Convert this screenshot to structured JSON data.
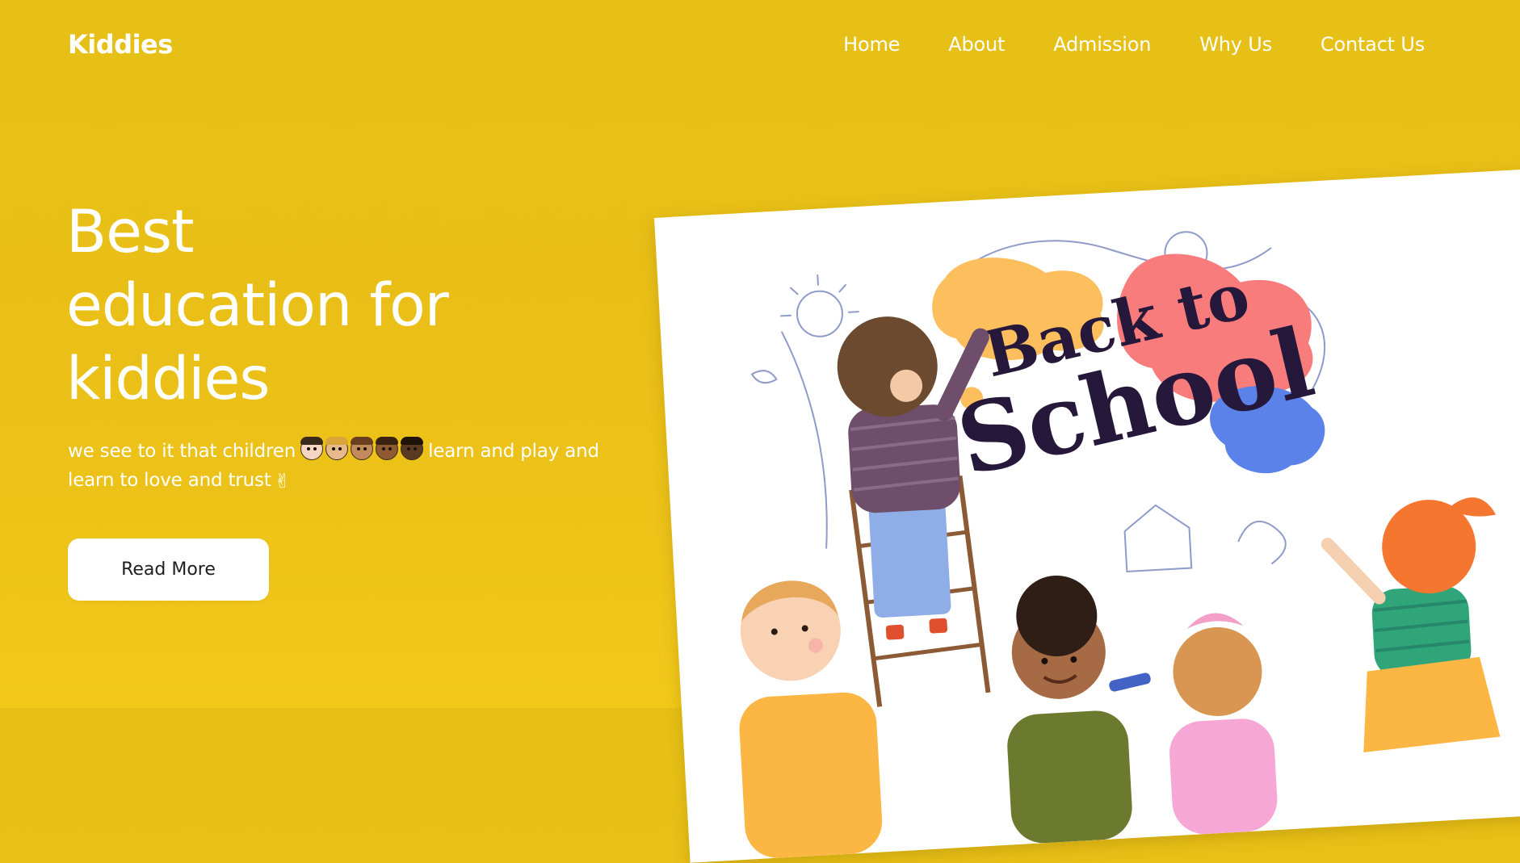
{
  "header": {
    "logo": "Kiddies",
    "nav": [
      "Home",
      "About",
      "Admission",
      "Why Us",
      "Contact Us"
    ]
  },
  "hero": {
    "title_lines": [
      "Best",
      "education for",
      "kiddies"
    ],
    "subtitle_start": "we see to it that children",
    "subtitle_end": "learn and play and learn to love and trust",
    "emoji_faces": [
      "child-light",
      "child-medium-light",
      "child-medium",
      "child-medium-dark",
      "child-dark"
    ],
    "read_more_label": "Read More"
  },
  "illustration": {
    "line1": "Back to",
    "line2": "School"
  },
  "colors": {
    "background": "#EAC017",
    "text": "#FFFFFF",
    "button_bg": "#FFFFFF",
    "button_text": "#1E1E1E"
  }
}
